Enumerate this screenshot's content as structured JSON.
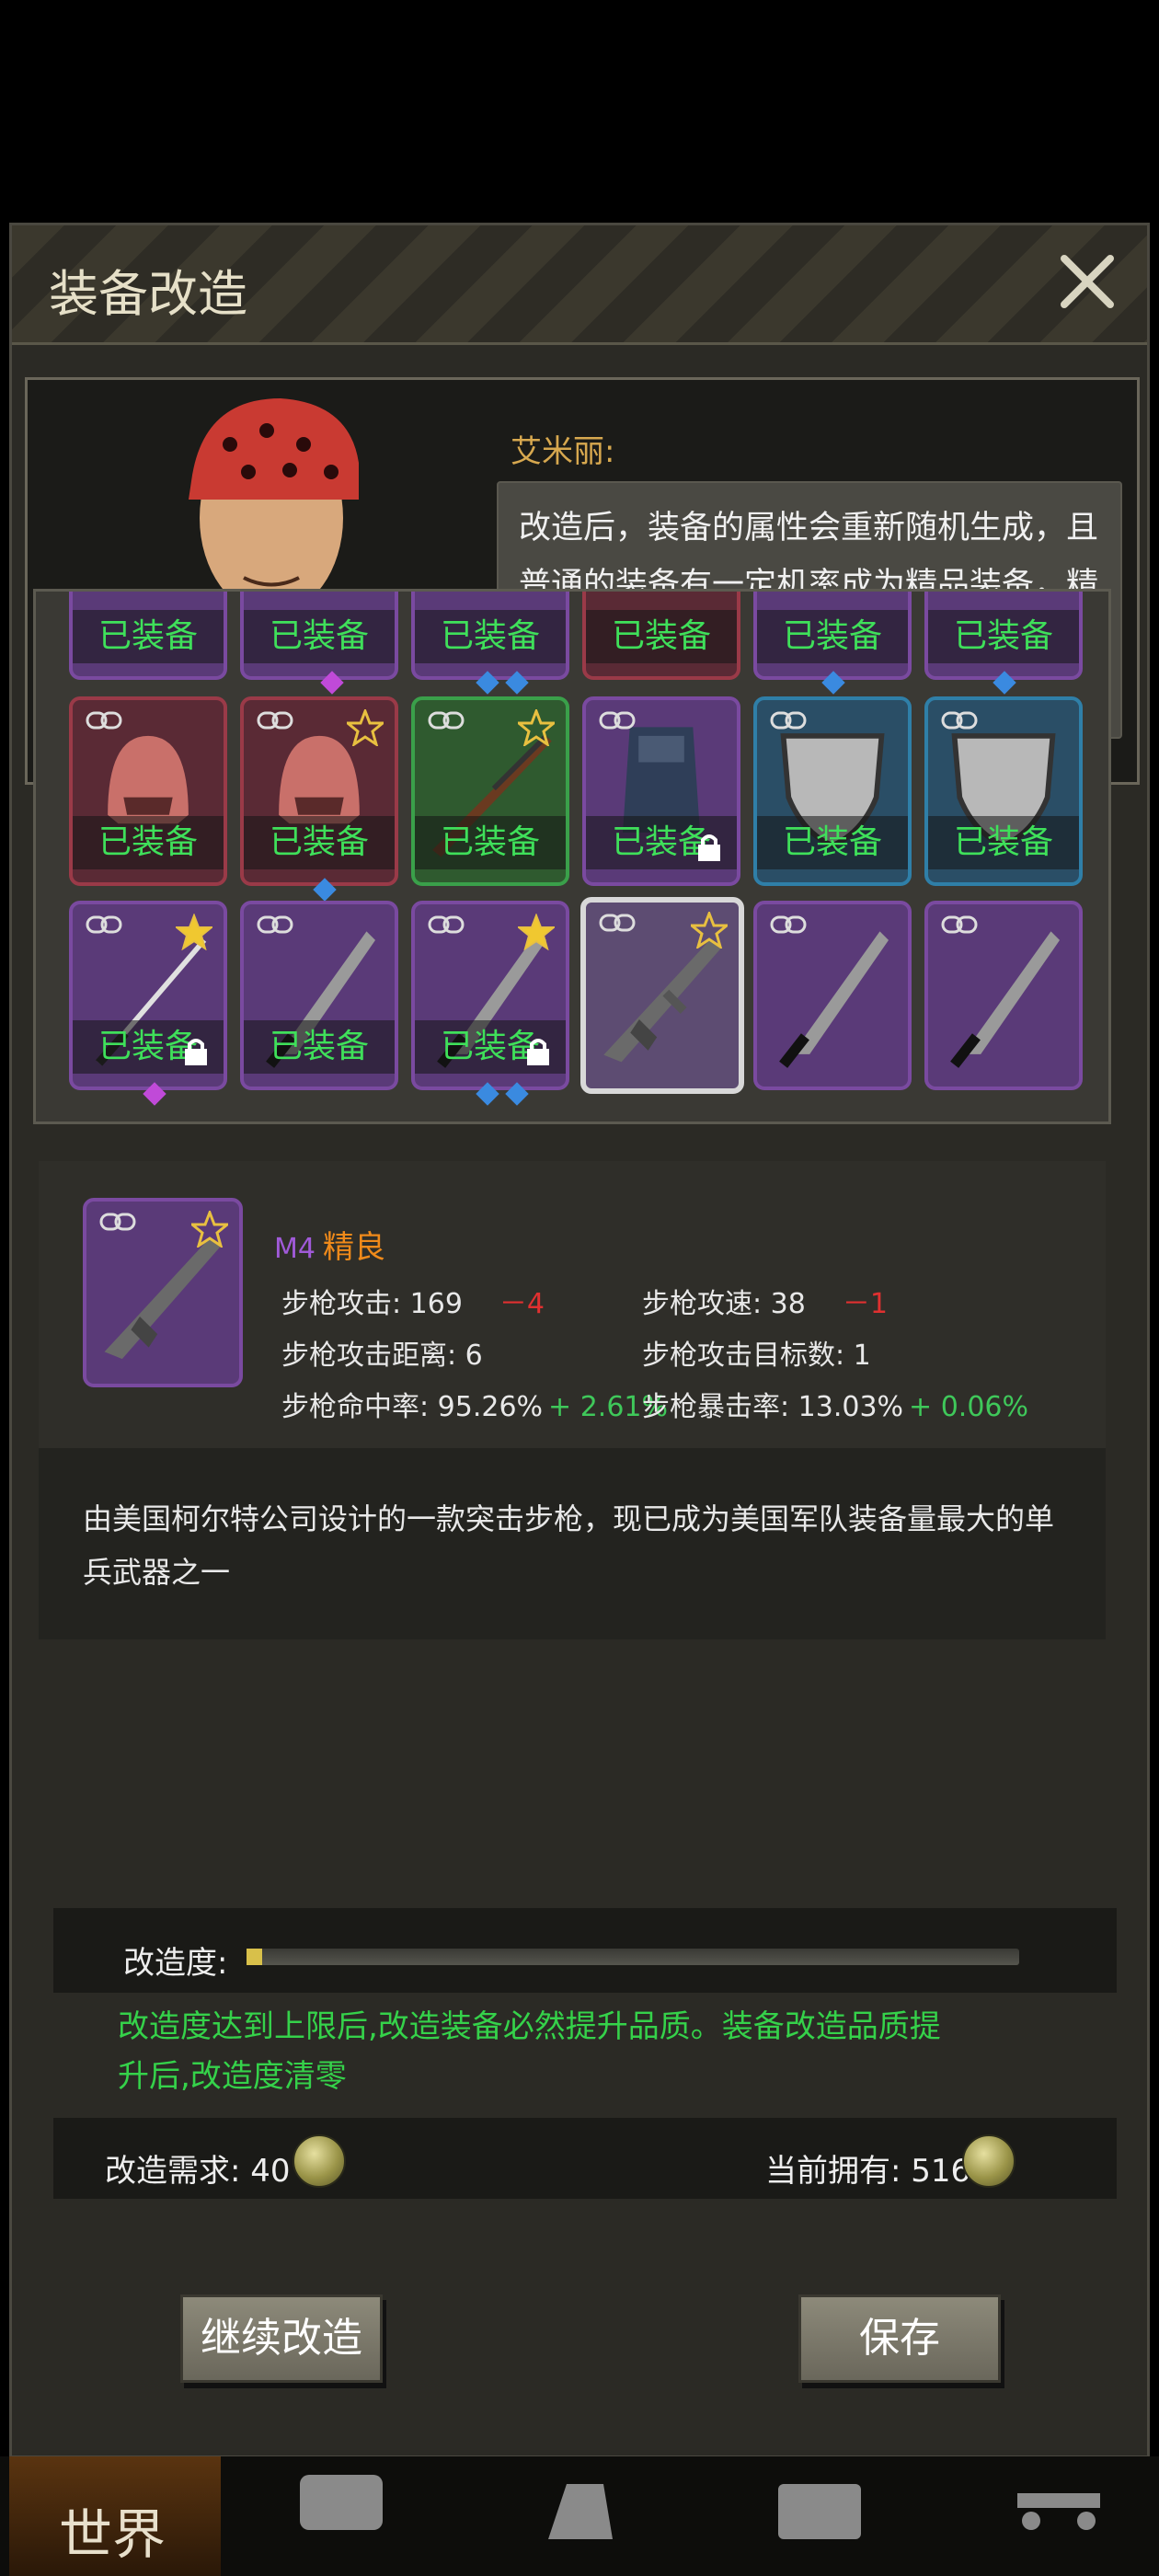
{
  "dialog": {
    "title": "装备改造",
    "close_icon": "close-icon"
  },
  "npc": {
    "speaker": "艾米丽:",
    "speech": "改造后，装备的属性会重新随机生成，且普通的装备有一定机率成为精品装备，精品的装备有一定机率成为完美装备。"
  },
  "inventory": {
    "equip_label": "已装备",
    "slots_top_partial": [
      {
        "label": "已装备",
        "color": "purple"
      },
      {
        "label": "已装备",
        "color": "purple"
      },
      {
        "label": "已装备",
        "color": "purple"
      },
      {
        "label": "已装备",
        "color": "red"
      },
      {
        "label": "已装备",
        "color": "purple"
      },
      {
        "label": "已装备",
        "color": "purple"
      }
    ],
    "row2": [
      {
        "item": "helmet-icon",
        "label": "已装备",
        "color": "red"
      },
      {
        "item": "helmet-icon",
        "label": "已装备",
        "color": "red"
      },
      {
        "item": "rifle-icon",
        "label": "已装备",
        "color": "green"
      },
      {
        "item": "armor-vest-icon",
        "label": "已装备",
        "color": "purple"
      },
      {
        "item": "shield-icon",
        "label": "已装备",
        "color": "blue"
      },
      {
        "item": "shield-icon",
        "label": "已装备",
        "color": "blue"
      }
    ],
    "row3": [
      {
        "item": "katana-icon",
        "label": "已装备",
        "color": "purple"
      },
      {
        "item": "machete-icon",
        "label": "已装备",
        "color": "purple"
      },
      {
        "item": "machete-icon",
        "label": "已装备",
        "color": "purple"
      },
      {
        "item": "assault-rifle-icon",
        "label": "",
        "color": "purple",
        "selected": true
      },
      {
        "item": "machete-icon",
        "label": "",
        "color": "purple"
      },
      {
        "item": "machete-icon",
        "label": "",
        "color": "purple"
      }
    ]
  },
  "item": {
    "model": "M4",
    "grade": "精良",
    "stats": {
      "attack": "步枪攻击: 169",
      "attack_delta": "－4",
      "speed": "步枪攻速: 38",
      "speed_delta": "－1",
      "range": "步枪攻击距离: 6",
      "targets": "步枪攻击目标数: 1",
      "hit": "步枪命中率: 95.26%",
      "hit_delta": "+ 2.61%",
      "crit": "步枪暴击率: 13.03%",
      "crit_delta": "+ 0.06%"
    },
    "description": "由美国柯尔特公司设计的一款突击步枪，现已成为美国军队装备量最大的单兵武器之一"
  },
  "modify": {
    "degree_label": "改造度:",
    "degree_value": 0.02,
    "notice": "改造度达到上限后,改造装备必然提升品质。装备改造品质提升后,改造度清零",
    "cost_label": "改造需求: 40",
    "owned_label": "当前拥有: 516",
    "coin_icon": "coin-icon"
  },
  "buttons": {
    "continue": "继续改造",
    "save": "保存"
  },
  "nav": {
    "world": "世界"
  }
}
